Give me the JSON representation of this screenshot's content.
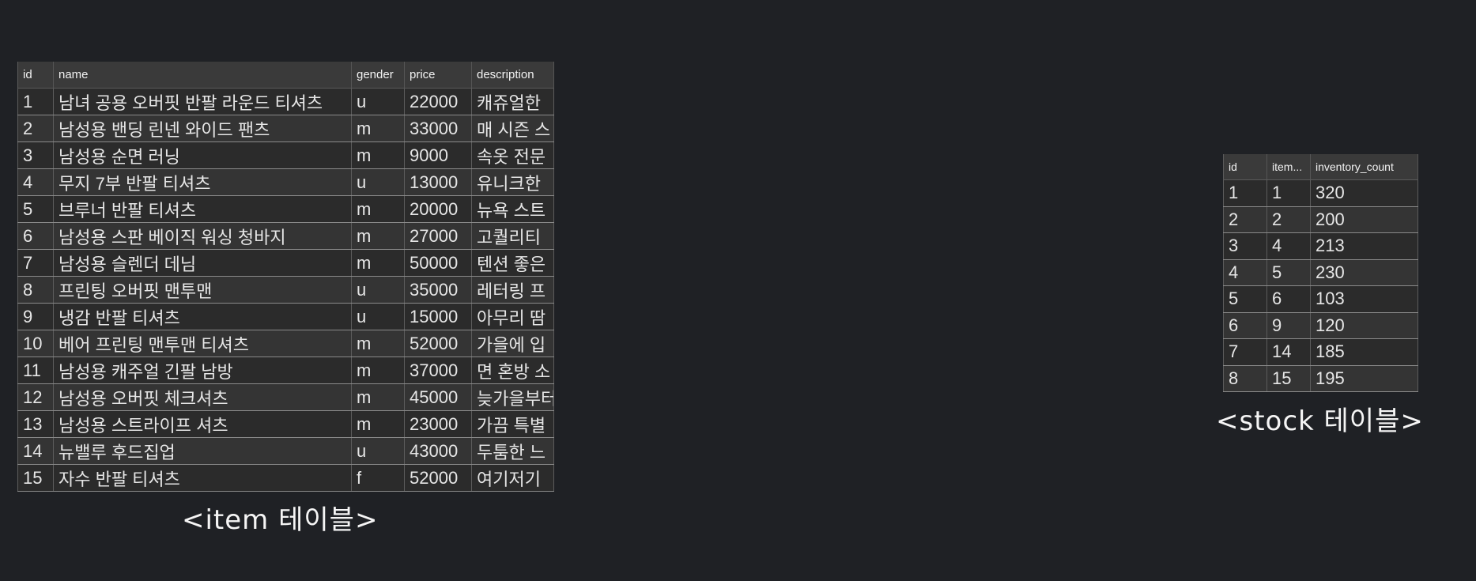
{
  "item_table": {
    "columns": [
      "id",
      "name",
      "gender",
      "price",
      "description"
    ],
    "rows": [
      [
        "1",
        "남녀 공용 오버핏 반팔 라운드 티셔츠",
        "u",
        "22000",
        "캐쥬얼한"
      ],
      [
        "2",
        "남성용 밴딩 린넨 와이드 팬츠",
        "m",
        "33000",
        "매 시즌 스"
      ],
      [
        "3",
        "남성용 순면 러닝",
        "m",
        "9000",
        "속옷 전문"
      ],
      [
        "4",
        "무지 7부 반팔 티셔츠",
        "u",
        "13000",
        "유니크한"
      ],
      [
        "5",
        "브루너 반팔 티셔츠",
        "m",
        "20000",
        "뉴욕 스트"
      ],
      [
        "6",
        "남성용 스판 베이직 워싱 청바지",
        "m",
        "27000",
        "고퀄리티"
      ],
      [
        "7",
        "남성용 슬렌더 데님",
        "m",
        "50000",
        "텐션 좋은"
      ],
      [
        "8",
        "프린팅 오버핏 맨투맨",
        "u",
        "35000",
        "레터링 프"
      ],
      [
        "9",
        "냉감 반팔 티셔츠",
        "u",
        "15000",
        "아무리 땀"
      ],
      [
        "10",
        "베어 프린팅 맨투맨 티셔츠",
        "m",
        "52000",
        "가을에 입"
      ],
      [
        "11",
        "남성용 캐주얼 긴팔 남방",
        "m",
        "37000",
        "면 혼방 소"
      ],
      [
        "12",
        "남성용 오버핏 체크셔츠",
        "m",
        "45000",
        "늦가을부터"
      ],
      [
        "13",
        "남성용 스트라이프 셔츠",
        "m",
        "23000",
        "가끔 특별"
      ],
      [
        "14",
        "뉴밸루 후드집업",
        "u",
        "43000",
        "두툼한 느"
      ],
      [
        "15",
        "자수 반팔 티셔츠",
        "f",
        "52000",
        "여기저기"
      ]
    ]
  },
  "stock_table": {
    "columns": [
      "id",
      "item...",
      "inventory_count"
    ],
    "rows": [
      [
        "1",
        "1",
        "320"
      ],
      [
        "2",
        "2",
        "200"
      ],
      [
        "3",
        "4",
        "213"
      ],
      [
        "4",
        "5",
        "230"
      ],
      [
        "5",
        "6",
        "103"
      ],
      [
        "6",
        "9",
        "120"
      ],
      [
        "7",
        "14",
        "185"
      ],
      [
        "8",
        "15",
        "195"
      ]
    ]
  },
  "captions": {
    "item": "<item 테이블>",
    "stock": "<stock 테이블>"
  }
}
